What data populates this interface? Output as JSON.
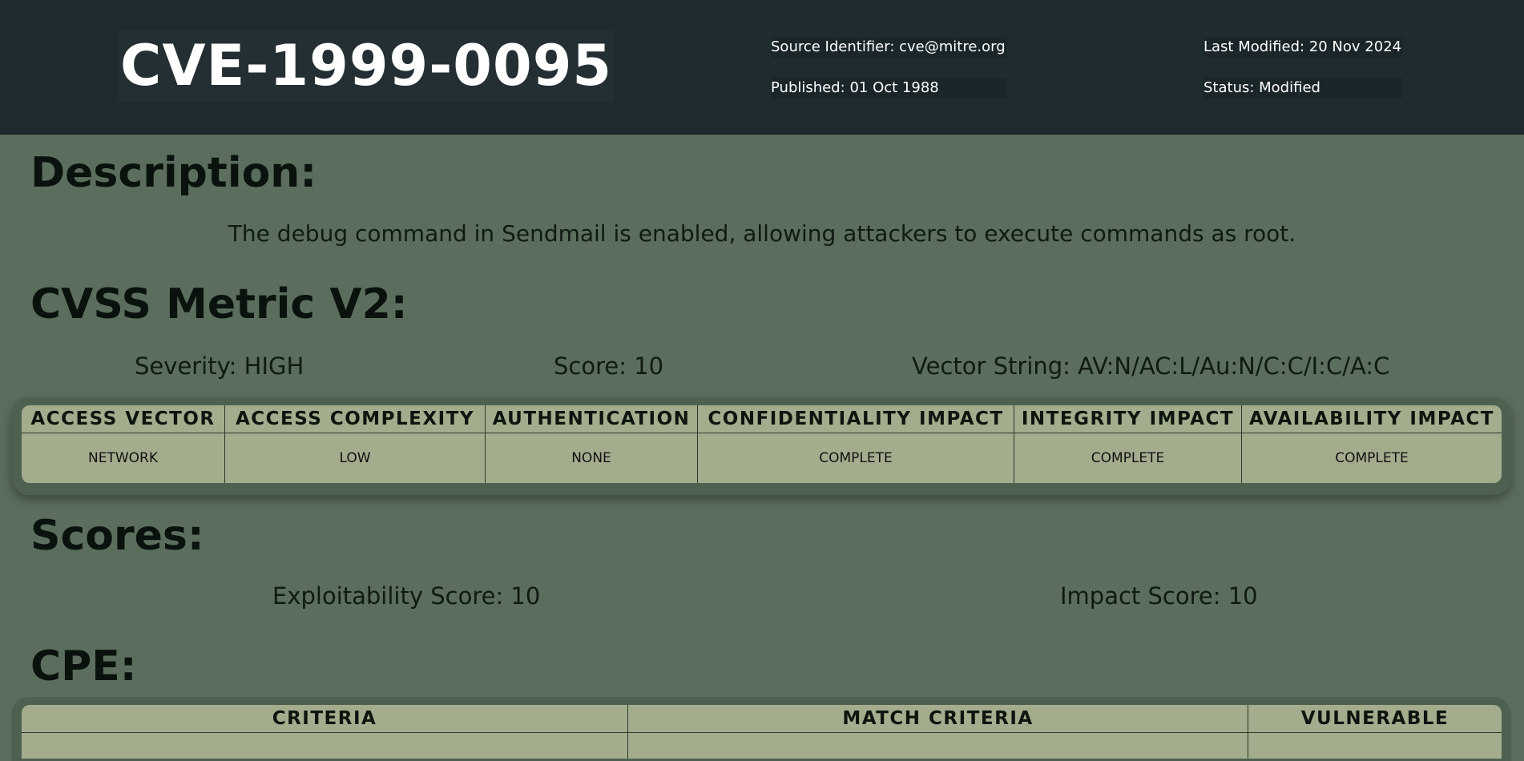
{
  "header": {
    "cve_id": "CVE-1999-0095",
    "source_identifier": "Source Identifier: cve@mitre.org",
    "published": "Published: 01 Oct 1988",
    "last_modified": "Last Modified: 20 Nov 2024",
    "status": "Status: Modified"
  },
  "description": {
    "heading": "Description:",
    "text": "The debug command in Sendmail is enabled, allowing attackers to execute commands as root."
  },
  "cvss": {
    "heading": "CVSS Metric V2:",
    "severity": "Severity: HIGH",
    "score": "Score: 10",
    "vector": "Vector String: AV:N/AC:L/Au:N/C:C/I:C/A:C",
    "columns": [
      "ACCESS VECTOR",
      "ACCESS COMPLEXITY",
      "AUTHENTICATION",
      "CONFIDENTIALITY IMPACT",
      "INTEGRITY IMPACT",
      "AVAILABILITY IMPACT"
    ],
    "values": [
      "NETWORK",
      "LOW",
      "NONE",
      "COMPLETE",
      "COMPLETE",
      "COMPLETE"
    ]
  },
  "scores": {
    "heading": "Scores:",
    "exploitability": "Exploitability Score: 10",
    "impact": "Impact Score: 10"
  },
  "cpe": {
    "heading": "CPE:",
    "columns": [
      "CRITERIA",
      "MATCH CRITERIA",
      "VULNERABLE"
    ]
  }
}
